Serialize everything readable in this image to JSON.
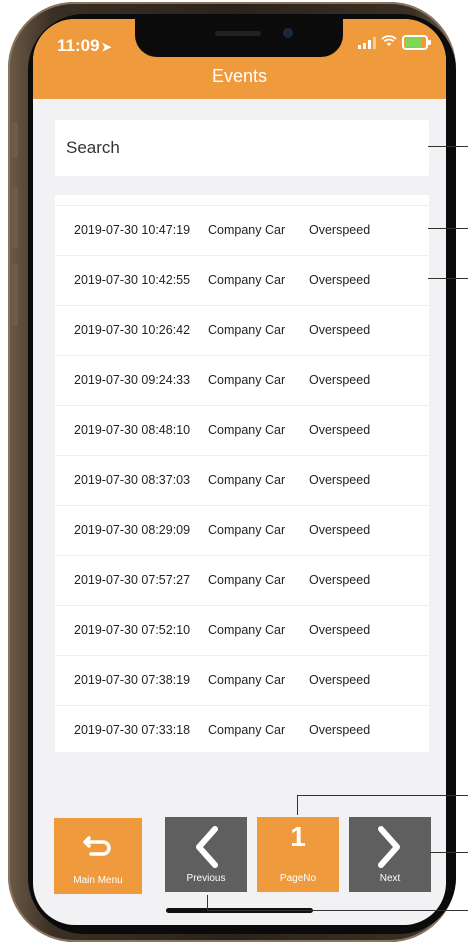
{
  "status": {
    "time": "11:09"
  },
  "header": {
    "title": "Events"
  },
  "search": {
    "placeholder": "Search"
  },
  "events": [
    {
      "datetime": "2019-07-30 10:47:19",
      "vehicle": "Company Car",
      "type": "Overspeed"
    },
    {
      "datetime": "2019-07-30 10:42:55",
      "vehicle": "Company Car",
      "type": "Overspeed"
    },
    {
      "datetime": "2019-07-30 10:26:42",
      "vehicle": "Company Car",
      "type": "Overspeed"
    },
    {
      "datetime": "2019-07-30 09:24:33",
      "vehicle": "Company Car",
      "type": "Overspeed"
    },
    {
      "datetime": "2019-07-30 08:48:10",
      "vehicle": "Company Car",
      "type": "Overspeed"
    },
    {
      "datetime": "2019-07-30 08:37:03",
      "vehicle": "Company Car",
      "type": "Overspeed"
    },
    {
      "datetime": "2019-07-30 08:29:09",
      "vehicle": "Company Car",
      "type": "Overspeed"
    },
    {
      "datetime": "2019-07-30 07:57:27",
      "vehicle": "Company Car",
      "type": "Overspeed"
    },
    {
      "datetime": "2019-07-30 07:52:10",
      "vehicle": "Company Car",
      "type": "Overspeed"
    },
    {
      "datetime": "2019-07-30 07:38:19",
      "vehicle": "Company Car",
      "type": "Overspeed"
    },
    {
      "datetime": "2019-07-30 07:33:18",
      "vehicle": "Company Car",
      "type": "Overspeed"
    }
  ],
  "toolbar": {
    "main_menu_label": "Main Menu",
    "previous_label": "Previous",
    "page_no_value": "1",
    "page_no_label": "PageNo",
    "next_label": "Next"
  },
  "colors": {
    "accent": "#ef9a3d",
    "button_gray": "#5f5f5f",
    "background": "#f2f2f4"
  }
}
